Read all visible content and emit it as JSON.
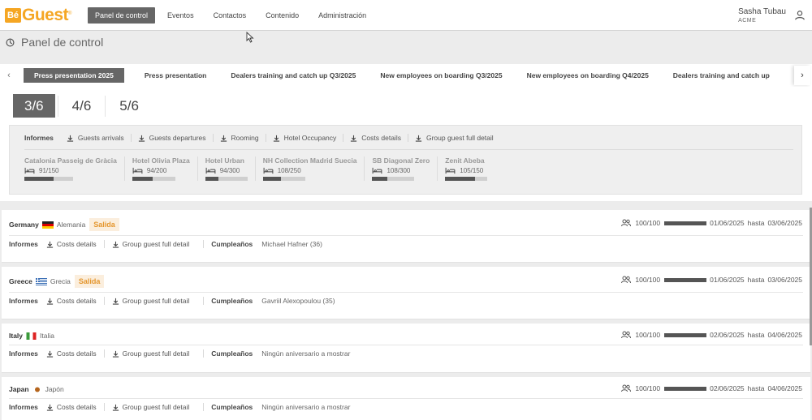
{
  "app": {
    "logo_mark": "Bé",
    "logo_text": "Guest",
    "logo_reg": "®"
  },
  "nav": {
    "items": [
      "Panel de control",
      "Eventos",
      "Contactos",
      "Contenido",
      "Administración"
    ],
    "active": "Panel de control"
  },
  "user": {
    "name": "Sasha Tubau",
    "org": "ACME",
    "icon": "user-icon"
  },
  "page": {
    "title": "Panel de control",
    "icon": "dashboard-icon"
  },
  "event_tabs": {
    "items": [
      "Press presentation 2025",
      "Press presentation",
      "Dealers training and catch up Q3/2025",
      "New employees on boarding Q3/2025",
      "New employees on boarding Q4/2025",
      "Dealers training and catch up"
    ],
    "left_arrow": "‹",
    "right_arrow": "›"
  },
  "counts": {
    "items": [
      "3/6",
      "4/6",
      "5/6"
    ]
  },
  "reports": {
    "title": "Informes",
    "links": [
      "Guests arrivals",
      "Guests departures",
      "Rooming",
      "Hotel Occupancy",
      "Costs details",
      "Group guest full detail"
    ]
  },
  "hotels": [
    {
      "name": "Catalonia Passeig de Gràcia",
      "occupancy": "91/150",
      "fraction": 0.607
    },
    {
      "name": "Hotel Olivia Plaza",
      "occupancy": "94/200",
      "fraction": 0.47
    },
    {
      "name": "Hotel Urban",
      "occupancy": "94/300",
      "fraction": 0.313
    },
    {
      "name": "NH Collection Madrid Suecia",
      "occupancy": "108/250",
      "fraction": 0.432
    },
    {
      "name": "SB Diagonal Zero",
      "occupancy": "108/300",
      "fraction": 0.36
    },
    {
      "name": "Zenit Abeba",
      "occupancy": "105/150",
      "fraction": 0.7
    }
  ],
  "countries": [
    {
      "name": "Germany",
      "local": "Alemania",
      "flag": "de",
      "badge": "Salida",
      "guests": "100/100",
      "from": "01/06/2025",
      "hasta": "hasta",
      "to": "03/06/2025",
      "reports_title": "Informes",
      "links": [
        "Costs details",
        "Group guest full detail"
      ],
      "birthday_label": "Cumpleaños",
      "birthday_value": "Michael Hafner (36)"
    },
    {
      "name": "Greece",
      "local": "Grecia",
      "flag": "gr",
      "badge": "Salida",
      "guests": "100/100",
      "from": "01/06/2025",
      "hasta": "hasta",
      "to": "03/06/2025",
      "reports_title": "Informes",
      "links": [
        "Costs details",
        "Group guest full detail"
      ],
      "birthday_label": "Cumpleaños",
      "birthday_value": "Gavriil Alexopoulou (35)"
    },
    {
      "name": "Italy",
      "local": "Italia",
      "flag": "it",
      "badge": "",
      "guests": "100/100",
      "from": "02/06/2025",
      "hasta": "hasta",
      "to": "04/06/2025",
      "reports_title": "Informes",
      "links": [
        "Costs details",
        "Group guest full detail"
      ],
      "birthday_label": "Cumpleaños",
      "birthday_value": "Ningún aniversario a mostrar"
    },
    {
      "name": "Japan",
      "local": "Japón",
      "flag": "jp",
      "badge": "",
      "guests": "100/100",
      "from": "02/06/2025",
      "hasta": "hasta",
      "to": "04/06/2025",
      "reports_title": "Informes",
      "links": [
        "Costs details",
        "Group guest full detail"
      ],
      "birthday_label": "Cumpleaños",
      "birthday_value": "Ningún aniversario a mostrar"
    }
  ],
  "colors": {
    "accent": "#f5a623",
    "nav_active": "#666666",
    "badge_bg": "#fbeedd",
    "badge_text": "#e4962e"
  }
}
